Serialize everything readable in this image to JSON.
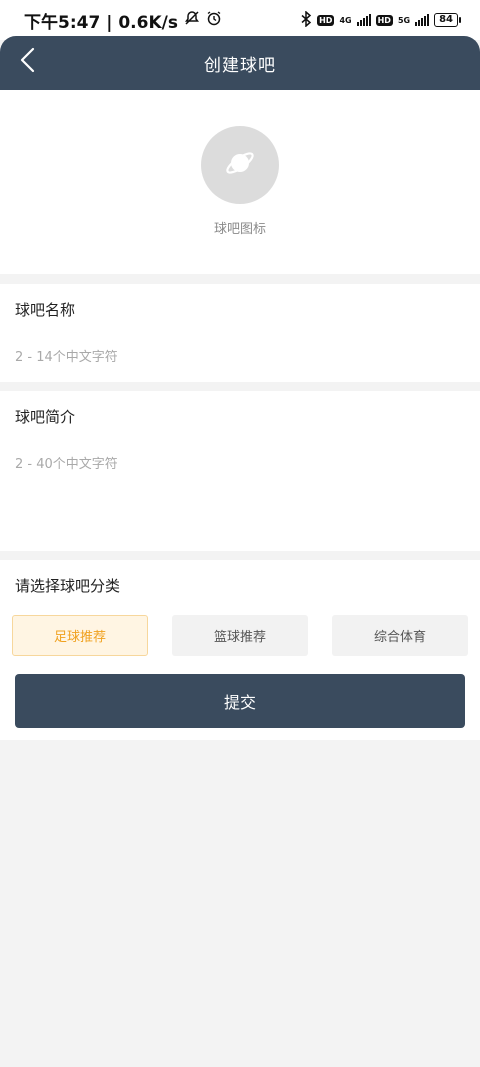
{
  "status_bar": {
    "time_speed": "下午5:47 | 0.6K/s",
    "hd_badge_1": "HD",
    "net_1": "4G",
    "hd_badge_2": "HD",
    "net_2": "5G",
    "battery": "84"
  },
  "header": {
    "title": "创建球吧",
    "back_icon": "chevron-left-icon"
  },
  "avatar": {
    "label": "球吧图标",
    "icon": "planet-icon"
  },
  "name_field": {
    "label": "球吧名称",
    "placeholder": "2 - 14个中文字符",
    "value": ""
  },
  "intro_field": {
    "label": "球吧简介",
    "placeholder": "2 - 40个中文字符",
    "value": ""
  },
  "category": {
    "label": "请选择球吧分类",
    "options": [
      {
        "label": "足球推荐",
        "selected": true
      },
      {
        "label": "篮球推荐",
        "selected": false
      },
      {
        "label": "综合体育",
        "selected": false
      }
    ]
  },
  "submit": {
    "label": "提交"
  },
  "colors": {
    "header_bg": "#3a4b5e",
    "accent": "#f0a11e",
    "page_bg": "#f3f3f3"
  }
}
